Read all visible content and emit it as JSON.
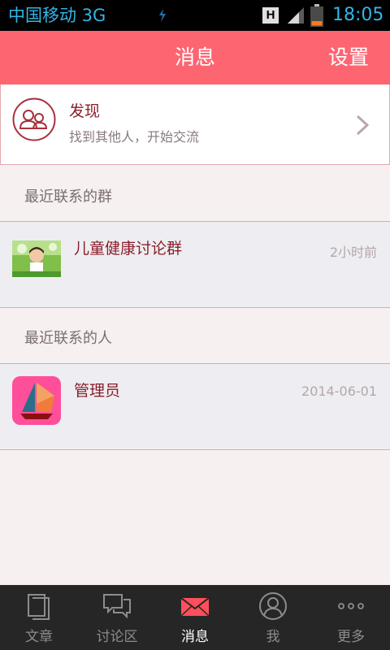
{
  "status_bar": {
    "carrier": "中国移动 3G",
    "network_badge": "H",
    "time": "18:05"
  },
  "header": {
    "title": "消息",
    "settings_label": "设置"
  },
  "discover": {
    "title": "发现",
    "subtitle": "找到其他人，开始交流",
    "icon": "people-icon"
  },
  "sections": {
    "recent_groups_label": "最近联系的群",
    "recent_people_label": "最近联系的人"
  },
  "groups": [
    {
      "name": "儿童健康讨论群",
      "time": "2小时前"
    }
  ],
  "people": [
    {
      "name": "管理员",
      "time": "2014-06-01"
    }
  ],
  "tabs": [
    {
      "label": "文章",
      "icon": "document-icon",
      "active": false
    },
    {
      "label": "讨论区",
      "icon": "chat-bubbles-icon",
      "active": false
    },
    {
      "label": "消息",
      "icon": "envelope-icon",
      "active": true
    },
    {
      "label": "我",
      "icon": "person-icon",
      "active": false
    },
    {
      "label": "更多",
      "icon": "more-dots-icon",
      "active": false
    }
  ],
  "colors": {
    "header": "#fd6571",
    "accent_text": "#8b1e2a",
    "tabbar": "#262626",
    "active_tab_icon": "#fd4f5c"
  }
}
